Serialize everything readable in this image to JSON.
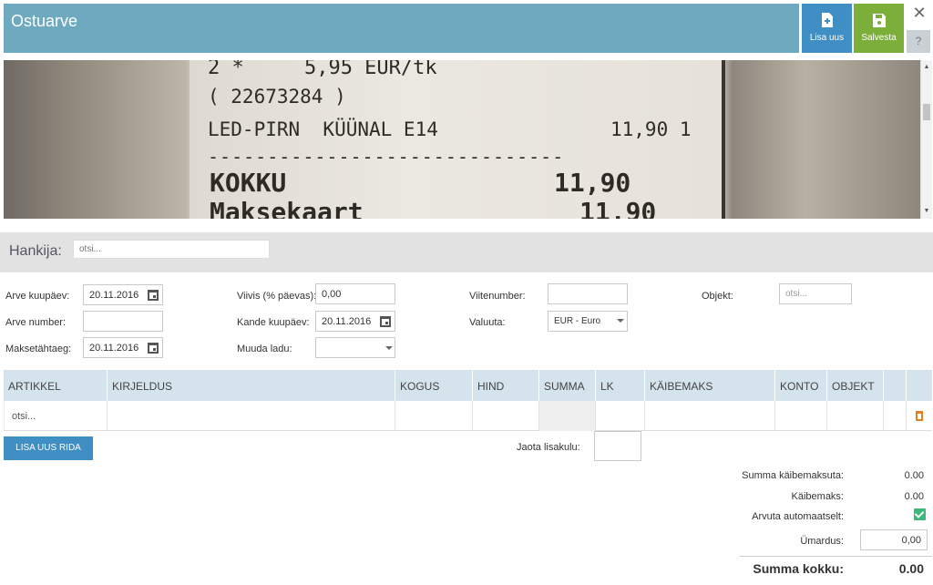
{
  "header": {
    "title": "Ostuarve",
    "new_label": "Lisa uus",
    "save_label": "Salvesta",
    "close_glyph": "✕",
    "help_glyph": "?"
  },
  "receipt": {
    "line1": "2 *     5,95 EUR/tk",
    "line2": "( 22673284 )",
    "line3_name": "LED-PIRN  KÜÜNAL E14",
    "line3_value": "11,90 1",
    "dashes": "------------------------------",
    "total_label": "KOKKU",
    "total_value": "11,90",
    "pay_label": "Maksekaart",
    "pay_value": "11,90"
  },
  "supplier": {
    "label": "Hankija:",
    "placeholder": "otsi..."
  },
  "form": {
    "invoice_date_label": "Arve kuupäev:",
    "invoice_date": "20.11.2016",
    "invoice_number_label": "Arve number:",
    "invoice_number": "",
    "due_date_label": "Maksetähtaeg:",
    "due_date": "20.11.2016",
    "penalty_label": "Viivis (% päevas):",
    "penalty": "0,00",
    "entry_date_label": "Kande kuupäev:",
    "entry_date": "20.11.2016",
    "warehouse_label": "Muuda ladu:",
    "warehouse": "",
    "reference_label": "Viitenumber:",
    "reference": "",
    "currency_label": "Valuuta:",
    "currency": "EUR - Euro",
    "object_label": "Objekt:",
    "object_placeholder": "otsi..."
  },
  "grid": {
    "columns": [
      "ARTIKKEL",
      "KIRJELDUS",
      "KOGUS",
      "HIND",
      "SUMMA",
      "LK",
      "KÄIBEMAKS",
      "KONTO",
      "OBJEKT"
    ],
    "row": {
      "article_placeholder": "otsi..."
    }
  },
  "actions": {
    "add_row": "LISA UUS RIDA",
    "distribute_label": "Jaota lisakulu:"
  },
  "totals": {
    "net_label": "Summa käibemaksuta:",
    "net": "0.00",
    "vat_label": "Käibemaks:",
    "vat": "0.00",
    "auto_label": "Arvuta automaatselt:",
    "auto_checked": true,
    "rounding_label": "Ümardus:",
    "rounding": "0,00",
    "grand_label": "Summa kokku:",
    "grand": "0.00"
  },
  "colors": {
    "header_bg": "#6ea9c0",
    "new_button": "#3f8fc4",
    "save_button": "#7cae3a",
    "grid_header": "#d4e3ec",
    "trash_icon": "#e67e22",
    "checkbox": "#3cb878"
  },
  "icons": {
    "new": "file-plus-icon",
    "save": "floppy-disk-icon",
    "close": "close-icon",
    "help": "help-icon",
    "calendar": "calendar-icon",
    "dropdown": "chevron-down-icon",
    "delete": "trash-icon",
    "check": "checkbox-checked-icon"
  }
}
